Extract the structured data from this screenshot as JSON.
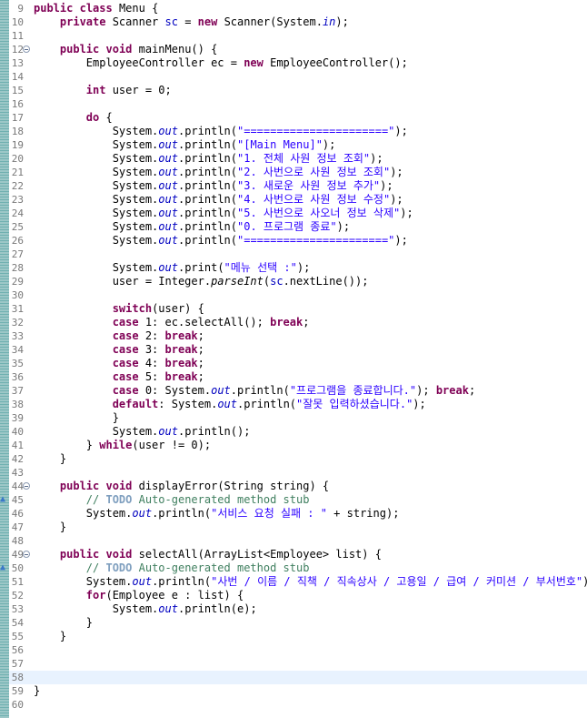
{
  "editor": {
    "language": "java",
    "current_line": 58,
    "line_markers": {
      "45": "override-marker",
      "50": "override-marker"
    },
    "fold_markers": [
      12,
      44,
      49
    ],
    "lines": [
      {
        "n": 9,
        "tokens": [
          {
            "t": "kw",
            "v": "public"
          },
          {
            "t": "p",
            "v": " "
          },
          {
            "t": "kw",
            "v": "class"
          },
          {
            "t": "p",
            "v": " Menu {"
          }
        ]
      },
      {
        "n": 10,
        "tokens": [
          {
            "t": "p",
            "v": "    "
          },
          {
            "t": "kw",
            "v": "private"
          },
          {
            "t": "p",
            "v": " Scanner "
          },
          {
            "t": "fld",
            "v": "sc"
          },
          {
            "t": "p",
            "v": " = "
          },
          {
            "t": "kw",
            "v": "new"
          },
          {
            "t": "p",
            "v": " Scanner(System."
          },
          {
            "t": "static",
            "v": "in"
          },
          {
            "t": "p",
            "v": ");"
          }
        ]
      },
      {
        "n": 11,
        "tokens": []
      },
      {
        "n": 12,
        "tokens": [
          {
            "t": "p",
            "v": "    "
          },
          {
            "t": "kw",
            "v": "public"
          },
          {
            "t": "p",
            "v": " "
          },
          {
            "t": "kw",
            "v": "void"
          },
          {
            "t": "p",
            "v": " mainMenu() {"
          }
        ]
      },
      {
        "n": 13,
        "tokens": [
          {
            "t": "p",
            "v": "        EmployeeController ec = "
          },
          {
            "t": "kw",
            "v": "new"
          },
          {
            "t": "p",
            "v": " EmployeeController();"
          }
        ]
      },
      {
        "n": 14,
        "tokens": []
      },
      {
        "n": 15,
        "tokens": [
          {
            "t": "p",
            "v": "        "
          },
          {
            "t": "kw",
            "v": "int"
          },
          {
            "t": "p",
            "v": " user = 0;"
          }
        ]
      },
      {
        "n": 16,
        "tokens": []
      },
      {
        "n": 17,
        "tokens": [
          {
            "t": "p",
            "v": "        "
          },
          {
            "t": "kw",
            "v": "do"
          },
          {
            "t": "p",
            "v": " {"
          }
        ]
      },
      {
        "n": 18,
        "tokens": [
          {
            "t": "p",
            "v": "            System."
          },
          {
            "t": "static",
            "v": "out"
          },
          {
            "t": "p",
            "v": ".println("
          },
          {
            "t": "str",
            "v": "\"======================\""
          },
          {
            "t": "p",
            "v": ");"
          }
        ]
      },
      {
        "n": 19,
        "tokens": [
          {
            "t": "p",
            "v": "            System."
          },
          {
            "t": "static",
            "v": "out"
          },
          {
            "t": "p",
            "v": ".println("
          },
          {
            "t": "str",
            "v": "\"[Main Menu]\""
          },
          {
            "t": "p",
            "v": ");"
          }
        ]
      },
      {
        "n": 20,
        "tokens": [
          {
            "t": "p",
            "v": "            System."
          },
          {
            "t": "static",
            "v": "out"
          },
          {
            "t": "p",
            "v": ".println("
          },
          {
            "t": "str",
            "v": "\"1. 전체 사원 정보 조회\""
          },
          {
            "t": "p",
            "v": ");"
          }
        ]
      },
      {
        "n": 21,
        "tokens": [
          {
            "t": "p",
            "v": "            System."
          },
          {
            "t": "static",
            "v": "out"
          },
          {
            "t": "p",
            "v": ".println("
          },
          {
            "t": "str",
            "v": "\"2. 사번으로 사원 정보 조회\""
          },
          {
            "t": "p",
            "v": ");"
          }
        ]
      },
      {
        "n": 22,
        "tokens": [
          {
            "t": "p",
            "v": "            System."
          },
          {
            "t": "static",
            "v": "out"
          },
          {
            "t": "p",
            "v": ".println("
          },
          {
            "t": "str",
            "v": "\"3. 새로운 사원 정보 추가\""
          },
          {
            "t": "p",
            "v": ");"
          }
        ]
      },
      {
        "n": 23,
        "tokens": [
          {
            "t": "p",
            "v": "            System."
          },
          {
            "t": "static",
            "v": "out"
          },
          {
            "t": "p",
            "v": ".println("
          },
          {
            "t": "str",
            "v": "\"4. 사번으로 사원 정보 수정\""
          },
          {
            "t": "p",
            "v": ");"
          }
        ]
      },
      {
        "n": 24,
        "tokens": [
          {
            "t": "p",
            "v": "            System."
          },
          {
            "t": "static",
            "v": "out"
          },
          {
            "t": "p",
            "v": ".println("
          },
          {
            "t": "str",
            "v": "\"5. 사번으로 사오너 정보 삭제\""
          },
          {
            "t": "p",
            "v": ");"
          }
        ]
      },
      {
        "n": 25,
        "tokens": [
          {
            "t": "p",
            "v": "            System."
          },
          {
            "t": "static",
            "v": "out"
          },
          {
            "t": "p",
            "v": ".println("
          },
          {
            "t": "str",
            "v": "\"0. 프로그램 종료\""
          },
          {
            "t": "p",
            "v": ");"
          }
        ]
      },
      {
        "n": 26,
        "tokens": [
          {
            "t": "p",
            "v": "            System."
          },
          {
            "t": "static",
            "v": "out"
          },
          {
            "t": "p",
            "v": ".println("
          },
          {
            "t": "str",
            "v": "\"======================\""
          },
          {
            "t": "p",
            "v": ");"
          }
        ]
      },
      {
        "n": 27,
        "tokens": []
      },
      {
        "n": 28,
        "tokens": [
          {
            "t": "p",
            "v": "            System."
          },
          {
            "t": "static",
            "v": "out"
          },
          {
            "t": "p",
            "v": ".print("
          },
          {
            "t": "str",
            "v": "\"메뉴 선택 :\""
          },
          {
            "t": "p",
            "v": ");"
          }
        ]
      },
      {
        "n": 29,
        "tokens": [
          {
            "t": "p",
            "v": "            user = Integer."
          },
          {
            "t": "smeth",
            "v": "parseInt"
          },
          {
            "t": "p",
            "v": "("
          },
          {
            "t": "fld",
            "v": "sc"
          },
          {
            "t": "p",
            "v": ".nextLine());"
          }
        ]
      },
      {
        "n": 30,
        "tokens": []
      },
      {
        "n": 31,
        "tokens": [
          {
            "t": "p",
            "v": "            "
          },
          {
            "t": "kw",
            "v": "switch"
          },
          {
            "t": "p",
            "v": "(user) {"
          }
        ]
      },
      {
        "n": 32,
        "tokens": [
          {
            "t": "p",
            "v": "            "
          },
          {
            "t": "kw",
            "v": "case"
          },
          {
            "t": "p",
            "v": " 1: ec.selectAll(); "
          },
          {
            "t": "kw",
            "v": "break"
          },
          {
            "t": "p",
            "v": ";"
          }
        ]
      },
      {
        "n": 33,
        "tokens": [
          {
            "t": "p",
            "v": "            "
          },
          {
            "t": "kw",
            "v": "case"
          },
          {
            "t": "p",
            "v": " 2: "
          },
          {
            "t": "kw",
            "v": "break"
          },
          {
            "t": "p",
            "v": ";"
          }
        ]
      },
      {
        "n": 34,
        "tokens": [
          {
            "t": "p",
            "v": "            "
          },
          {
            "t": "kw",
            "v": "case"
          },
          {
            "t": "p",
            "v": " 3: "
          },
          {
            "t": "kw",
            "v": "break"
          },
          {
            "t": "p",
            "v": ";"
          }
        ]
      },
      {
        "n": 35,
        "tokens": [
          {
            "t": "p",
            "v": "            "
          },
          {
            "t": "kw",
            "v": "case"
          },
          {
            "t": "p",
            "v": " 4: "
          },
          {
            "t": "kw",
            "v": "break"
          },
          {
            "t": "p",
            "v": ";"
          }
        ]
      },
      {
        "n": 36,
        "tokens": [
          {
            "t": "p",
            "v": "            "
          },
          {
            "t": "kw",
            "v": "case"
          },
          {
            "t": "p",
            "v": " 5: "
          },
          {
            "t": "kw",
            "v": "break"
          },
          {
            "t": "p",
            "v": ";"
          }
        ]
      },
      {
        "n": 37,
        "tokens": [
          {
            "t": "p",
            "v": "            "
          },
          {
            "t": "kw",
            "v": "case"
          },
          {
            "t": "p",
            "v": " 0: System."
          },
          {
            "t": "static",
            "v": "out"
          },
          {
            "t": "p",
            "v": ".println("
          },
          {
            "t": "str",
            "v": "\"프로그램을 종료합니다.\""
          },
          {
            "t": "p",
            "v": "); "
          },
          {
            "t": "kw",
            "v": "break"
          },
          {
            "t": "p",
            "v": ";"
          }
        ]
      },
      {
        "n": 38,
        "tokens": [
          {
            "t": "p",
            "v": "            "
          },
          {
            "t": "kw",
            "v": "default"
          },
          {
            "t": "p",
            "v": ": System."
          },
          {
            "t": "static",
            "v": "out"
          },
          {
            "t": "p",
            "v": ".println("
          },
          {
            "t": "str",
            "v": "\"잘못 입력하셨습니다.\""
          },
          {
            "t": "p",
            "v": ");"
          }
        ]
      },
      {
        "n": 39,
        "tokens": [
          {
            "t": "p",
            "v": "            }"
          }
        ]
      },
      {
        "n": 40,
        "tokens": [
          {
            "t": "p",
            "v": "            System."
          },
          {
            "t": "static",
            "v": "out"
          },
          {
            "t": "p",
            "v": ".println();"
          }
        ]
      },
      {
        "n": 41,
        "tokens": [
          {
            "t": "p",
            "v": "        } "
          },
          {
            "t": "kw",
            "v": "while"
          },
          {
            "t": "p",
            "v": "(user != 0);"
          }
        ]
      },
      {
        "n": 42,
        "tokens": [
          {
            "t": "p",
            "v": "    }"
          }
        ]
      },
      {
        "n": 43,
        "tokens": []
      },
      {
        "n": 44,
        "tokens": [
          {
            "t": "p",
            "v": "    "
          },
          {
            "t": "kw",
            "v": "public"
          },
          {
            "t": "p",
            "v": " "
          },
          {
            "t": "kw",
            "v": "void"
          },
          {
            "t": "p",
            "v": " displayError(String string) {"
          }
        ]
      },
      {
        "n": 45,
        "tokens": [
          {
            "t": "cmt",
            "v": "        // "
          },
          {
            "t": "todo",
            "v": "TODO"
          },
          {
            "t": "cmt",
            "v": " Auto-generated method stub"
          }
        ]
      },
      {
        "n": 46,
        "tokens": [
          {
            "t": "p",
            "v": "        System."
          },
          {
            "t": "static",
            "v": "out"
          },
          {
            "t": "p",
            "v": ".println("
          },
          {
            "t": "str",
            "v": "\"서비스 요청 실패 : \""
          },
          {
            "t": "p",
            "v": " + string);"
          }
        ]
      },
      {
        "n": 47,
        "tokens": [
          {
            "t": "p",
            "v": "    }"
          }
        ]
      },
      {
        "n": 48,
        "tokens": []
      },
      {
        "n": 49,
        "tokens": [
          {
            "t": "p",
            "v": "    "
          },
          {
            "t": "kw",
            "v": "public"
          },
          {
            "t": "p",
            "v": " "
          },
          {
            "t": "kw",
            "v": "void"
          },
          {
            "t": "p",
            "v": " selectAll(ArrayList<Employee> list) {"
          }
        ]
      },
      {
        "n": 50,
        "tokens": [
          {
            "t": "cmt",
            "v": "        // "
          },
          {
            "t": "todo",
            "v": "TODO"
          },
          {
            "t": "cmt",
            "v": " Auto-generated method stub"
          }
        ]
      },
      {
        "n": 51,
        "tokens": [
          {
            "t": "p",
            "v": "        System."
          },
          {
            "t": "static",
            "v": "out"
          },
          {
            "t": "p",
            "v": ".println("
          },
          {
            "t": "str",
            "v": "\"사번 / 이름 / 직책 / 직속상사 / 고용일 / 급여 / 커미션 / 부서번호\""
          },
          {
            "t": "p",
            "v": ");"
          }
        ]
      },
      {
        "n": 52,
        "tokens": [
          {
            "t": "p",
            "v": "        "
          },
          {
            "t": "kw",
            "v": "for"
          },
          {
            "t": "p",
            "v": "(Employee e : list) {"
          }
        ]
      },
      {
        "n": 53,
        "tokens": [
          {
            "t": "p",
            "v": "            System."
          },
          {
            "t": "static",
            "v": "out"
          },
          {
            "t": "p",
            "v": ".println(e);"
          }
        ]
      },
      {
        "n": 54,
        "tokens": [
          {
            "t": "p",
            "v": "        }"
          }
        ]
      },
      {
        "n": 55,
        "tokens": [
          {
            "t": "p",
            "v": "    }"
          }
        ]
      },
      {
        "n": 56,
        "tokens": []
      },
      {
        "n": 57,
        "tokens": []
      },
      {
        "n": 58,
        "tokens": []
      },
      {
        "n": 59,
        "tokens": [
          {
            "t": "p",
            "v": "}"
          }
        ]
      },
      {
        "n": 60,
        "tokens": []
      }
    ]
  }
}
